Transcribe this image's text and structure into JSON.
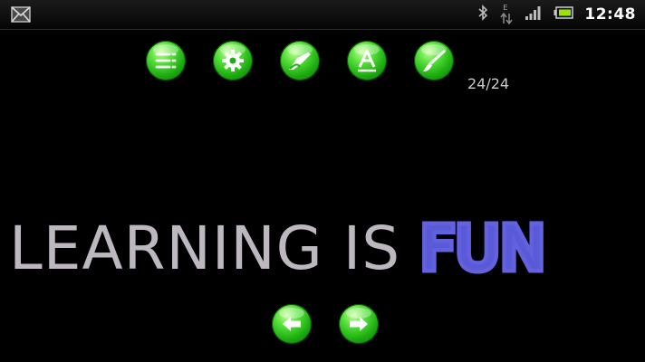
{
  "status_bar": {
    "time": "12:48",
    "data_indicator": "E",
    "icons": [
      "message-icon",
      "bluetooth-icon",
      "data-arrows-icon",
      "signal-icon",
      "battery-icon"
    ]
  },
  "toolbar": {
    "buttons": [
      "menu-list-icon",
      "settings-gear-icon",
      "eraser-icon",
      "font-icon",
      "brush-icon"
    ],
    "counter": "24/24"
  },
  "slide": {
    "text_plain": "LEARNING IS ",
    "text_highlight": "FUN"
  },
  "navigation": {
    "buttons": [
      "previous-arrow-icon",
      "next-arrow-icon"
    ]
  },
  "colors": {
    "background": "#000000",
    "button_green": "#2ec71d",
    "text_gray": "#bdb7bf",
    "highlight_blue": "#5a5ad8"
  }
}
